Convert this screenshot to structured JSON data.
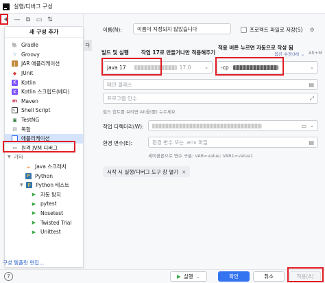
{
  "window": {
    "title": "실행/디버그 구성"
  },
  "left": {
    "popup_title": "새 구성 추가",
    "items": [
      {
        "label": "Gradle",
        "icon": "gradle-icon",
        "color": "#02303a"
      },
      {
        "label": "Groovy",
        "icon": "groovy-icon",
        "color": "#4aa2c6"
      },
      {
        "label": "JAR 애플리케이션",
        "icon": "jar-icon",
        "color": "#c28b3f"
      },
      {
        "label": "JUnit",
        "icon": "junit-icon",
        "color": "#d63939"
      },
      {
        "label": "Kotlin",
        "icon": "kotlin-icon",
        "color": "#7f52ff"
      },
      {
        "label": "Kotlin 스크립트(베타)",
        "icon": "kotlin-script-icon",
        "color": "#7f52ff"
      },
      {
        "label": "Maven",
        "icon": "maven-icon",
        "color": "#c71a36"
      },
      {
        "label": "Shell Script",
        "icon": "shell-icon",
        "color": "#444444"
      },
      {
        "label": "TestNG",
        "icon": "testng-icon",
        "color": "#2d7d3c"
      },
      {
        "label": "복합",
        "icon": "compound-icon",
        "color": "#8a8f96"
      },
      {
        "label": "애플리케이션",
        "icon": "application-icon",
        "color": "#3574f0"
      },
      {
        "label": "원격 JVM 디버그",
        "icon": "remote-debug-icon",
        "color": "#5a6a7a"
      }
    ],
    "group_other": "기타",
    "other_items": [
      {
        "label": "Java 스크래치",
        "icon": "java-scratch-icon",
        "color": "#e07b2b"
      },
      {
        "label": "Python",
        "icon": "python-icon",
        "color": "#3776ab"
      },
      {
        "label": "Python 테스트",
        "icon": "python-test-icon",
        "color": "#3776ab"
      }
    ],
    "python_test_items": [
      {
        "label": "자동 탐지",
        "icon": "autodetect-icon"
      },
      {
        "label": "pytest",
        "icon": "pytest-icon"
      },
      {
        "label": "Nosetest",
        "icon": "nosetest-icon"
      },
      {
        "label": "Twisted Trial",
        "icon": "twisted-icon"
      },
      {
        "label": "Unittest",
        "icon": "unittest-icon"
      }
    ],
    "footer_link": "구성 템플릿 편집..."
  },
  "side_tab": "다",
  "form": {
    "name_label": "이름(N):",
    "name_value": "이름이 지정되지 않았습니다",
    "store_as_project_file": "프로젝트 파일로 저장(S)",
    "build_and_run": "빌드 및 실행",
    "annotation_left": "작업 17로 만들거나만 적용해주기",
    "annotation_right": "적용 버튼 누르면 자동으로 작성 됨",
    "modify_options": "옵션 수정(M)",
    "modify_shortcut": "Alt+M",
    "jdk_value": "java 17",
    "jdk_version": "17.0",
    "cp_prefix": "-cp",
    "main_class_placeholder": "메인 클래스",
    "program_args_placeholder": "프로그램 인수",
    "args_hint": "필드 힌트를 보려면 Alt을(를) 누르세요",
    "working_dir_label": "작업 디렉터리(W):",
    "env_label": "환경 변수(E):",
    "env_placeholder": "환경 변수 또는 .env 파일",
    "env_hint": "세미콜론으로 변수 구분: VAR=value; VAR1=value1",
    "open_tool_window": "시작 시 실행/디버그 도구 창 열기"
  },
  "bottom": {
    "help": "?",
    "run": "실행",
    "ok": "확인",
    "cancel": "취소",
    "apply": "적용(A)"
  },
  "colors": {
    "highlight": "#e21b23",
    "primary": "#3574f0",
    "selected": "#d5e4fb"
  }
}
